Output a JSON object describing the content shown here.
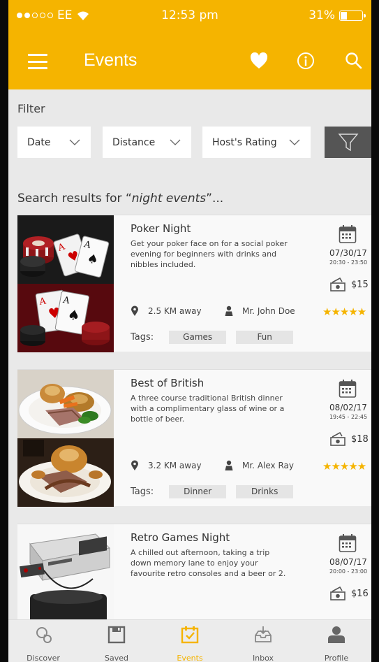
{
  "status_bar": {
    "carrier": "EE",
    "time": "12:53 pm",
    "battery": "31%",
    "signal_bars_filled": 2,
    "signal_bars_total": 5
  },
  "app_bar": {
    "title": "Events",
    "icons": [
      "menu-icon",
      "heart-icon",
      "info-icon",
      "search-icon"
    ],
    "color": "#f5b400"
  },
  "filter": {
    "label": "Filter",
    "dropdowns": [
      {
        "label": "Date"
      },
      {
        "label": "Distance"
      },
      {
        "label": "Host's Rating"
      }
    ],
    "button_icon": "funnel-icon"
  },
  "results": {
    "prefix": "Search results for “",
    "query": "night events",
    "suffix": "”..."
  },
  "events": [
    {
      "title": "Poker Night",
      "description": "Get your poker face on for a social poker evening for beginners with drinks and nibbles included.",
      "date": "07/30/17",
      "time": "20:30 - 23:50",
      "price": "$15",
      "distance": "2.5 KM away",
      "host": "Mr. John Doe",
      "rating": 5,
      "tags_label": "Tags:",
      "tags": [
        "Games",
        "Fun"
      ]
    },
    {
      "title": "Best of British",
      "description": "A three course traditional British dinner with a complimentary glass of wine or a bottle of beer.",
      "date": "08/02/17",
      "time": "19:45 - 22:45",
      "price": "$18",
      "distance": "3.2 KM away",
      "host": "Mr. Alex Ray",
      "rating": 5,
      "tags_label": "Tags:",
      "tags": [
        "Dinner",
        "Drinks"
      ]
    },
    {
      "title": "Retro Games Night",
      "description": "A chilled out afternoon, taking a trip down memory lane to enjoy your favourite retro consoles and a beer or 2.",
      "date": "08/07/17",
      "time": "20:00 - 23:00",
      "price": "$16"
    }
  ],
  "tab_bar": {
    "tabs": [
      {
        "label": "Discover",
        "icon": "discover-icon"
      },
      {
        "label": "Saved",
        "icon": "save-icon"
      },
      {
        "label": "Events",
        "icon": "calendar-icon",
        "active": true
      },
      {
        "label": "Inbox",
        "icon": "inbox-icon"
      },
      {
        "label": "Profile",
        "icon": "profile-icon"
      }
    ],
    "active_color": "#f5b400"
  }
}
